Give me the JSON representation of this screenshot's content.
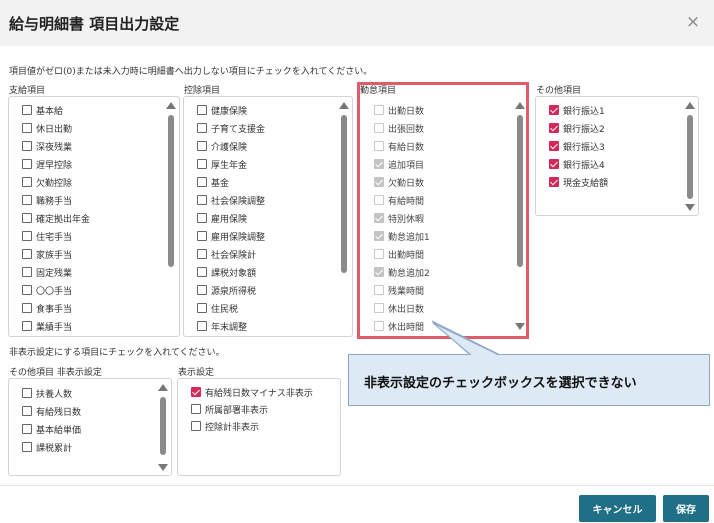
{
  "dialog": {
    "title": "給与明細書 項目出力設定",
    "close_icon": "×"
  },
  "notes": {
    "top": "項目値がゼロ(0)または未入力時に明細書へ出力しない項目にチェックを入れてください。",
    "middle": "非表示設定にする項目にチェックを入れてください。"
  },
  "groups": {
    "payment": {
      "label": "支給項目",
      "items": [
        {
          "label": "基本給",
          "checked": false
        },
        {
          "label": "休日出勤",
          "checked": false
        },
        {
          "label": "深夜残業",
          "checked": false
        },
        {
          "label": "遅早控除",
          "checked": false
        },
        {
          "label": "欠勤控除",
          "checked": false
        },
        {
          "label": "職務手当",
          "checked": false
        },
        {
          "label": "確定拠出年金",
          "checked": false
        },
        {
          "label": "住宅手当",
          "checked": false
        },
        {
          "label": "家族手当",
          "checked": false
        },
        {
          "label": "固定残業",
          "checked": false
        },
        {
          "label": "〇〇手当",
          "checked": false
        },
        {
          "label": "食事手当",
          "checked": false
        },
        {
          "label": "業績手当",
          "checked": false
        }
      ]
    },
    "deduction": {
      "label": "控除項目",
      "items": [
        {
          "label": "健康保険",
          "checked": false
        },
        {
          "label": "子育て支援金",
          "checked": false
        },
        {
          "label": "介護保険",
          "checked": false
        },
        {
          "label": "厚生年金",
          "checked": false
        },
        {
          "label": "基金",
          "checked": false
        },
        {
          "label": "社会保険調整",
          "checked": false
        },
        {
          "label": "雇用保険",
          "checked": false
        },
        {
          "label": "雇用保険調整",
          "checked": false
        },
        {
          "label": "社会保険計",
          "checked": false
        },
        {
          "label": "課税対象額",
          "checked": false
        },
        {
          "label": "源泉所得税",
          "checked": false
        },
        {
          "label": "住民税",
          "checked": false
        },
        {
          "label": "年末調整",
          "checked": false
        }
      ]
    },
    "attendance": {
      "label": "勤怠項目",
      "items": [
        {
          "label": "出勤日数",
          "checked": false
        },
        {
          "label": "出張回数",
          "checked": false
        },
        {
          "label": "有給日数",
          "checked": false
        },
        {
          "label": "追加項目",
          "checked": true
        },
        {
          "label": "欠勤日数",
          "checked": true
        },
        {
          "label": "有給時間",
          "checked": false
        },
        {
          "label": "特別休暇",
          "checked": true
        },
        {
          "label": "勤怠追加1",
          "checked": true
        },
        {
          "label": "出勤時間",
          "checked": false
        },
        {
          "label": "勤怠追加2",
          "checked": true
        },
        {
          "label": "残業時間",
          "checked": false
        },
        {
          "label": "休出日数",
          "checked": false
        },
        {
          "label": "休出時間",
          "checked": false
        }
      ]
    },
    "other": {
      "label": "その他項目",
      "items": [
        {
          "label": "銀行振込1",
          "checked": true
        },
        {
          "label": "銀行振込2",
          "checked": true
        },
        {
          "label": "銀行振込3",
          "checked": true
        },
        {
          "label": "銀行振込4",
          "checked": true
        },
        {
          "label": "現金支給額",
          "checked": true
        }
      ]
    },
    "other_hidden": {
      "label": "その他項目 非表示設定",
      "items": [
        {
          "label": "扶養人数",
          "checked": false
        },
        {
          "label": "有給残日数",
          "checked": false
        },
        {
          "label": "基本給単価",
          "checked": false
        },
        {
          "label": "課税累計",
          "checked": false
        }
      ]
    },
    "display": {
      "label": "表示設定",
      "items": [
        {
          "label": "有給残日数マイナス非表示",
          "checked": true
        },
        {
          "label": "所属部署非表示",
          "checked": false
        },
        {
          "label": "控除計非表示",
          "checked": false
        }
      ]
    }
  },
  "callout": {
    "text": "非表示設定のチェックボックスを選択できない"
  },
  "footer": {
    "cancel_label": "キャンセル",
    "save_label": "保存"
  },
  "colors": {
    "accent": "#d6275a",
    "button": "#1f6f86",
    "highlight": "#e05c6a",
    "callout_bg": "#dde9f5"
  }
}
